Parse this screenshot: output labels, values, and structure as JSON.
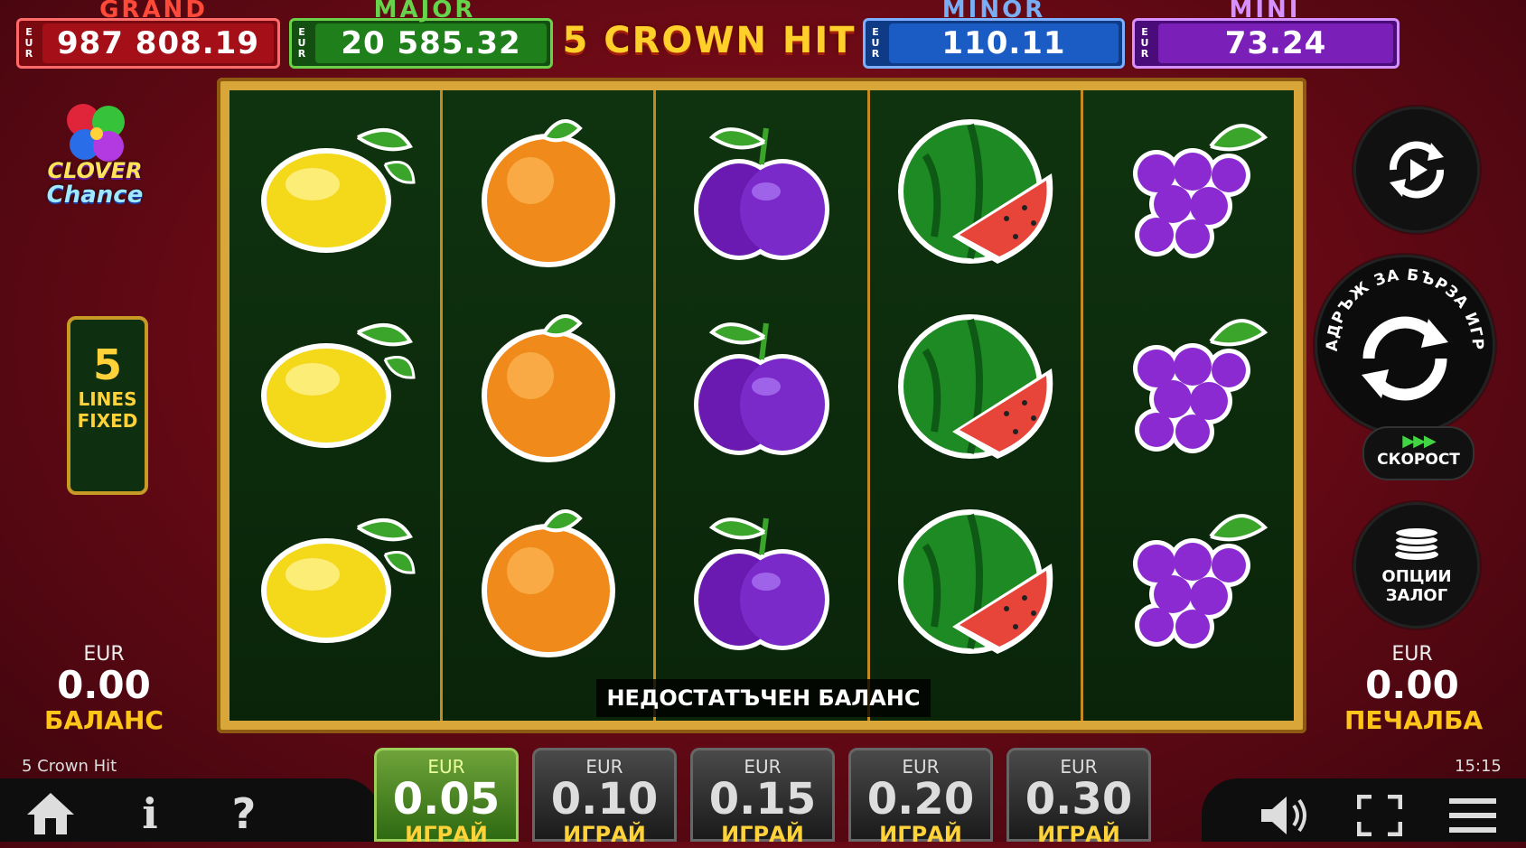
{
  "jackpots": [
    {
      "name": "GRAND",
      "currency": "EUR",
      "value": "987 808.19",
      "color": "#c0141e",
      "title_color": "#ff4a3a"
    },
    {
      "name": "MAJOR",
      "currency": "EUR",
      "value": "20 585.32",
      "color": "#1f7f1a",
      "title_color": "#66d44a"
    },
    {
      "name": "MINOR",
      "currency": "EUR",
      "value": "110.11",
      "color": "#1a5bc4",
      "title_color": "#79aef5"
    },
    {
      "name": "MINI",
      "currency": "EUR",
      "value": "73.24",
      "color": "#7a1fb8",
      "title_color": "#d690ff"
    }
  ],
  "game_logo": "5 CROWN HIT",
  "clover_logo": {
    "line1": "CLOVER",
    "line2": "Chance"
  },
  "lines_badge": {
    "number": "5",
    "line1": "LINES",
    "line2": "FIXED"
  },
  "balance": {
    "currency": "EUR",
    "value": "0.00",
    "label": "БАЛАНС"
  },
  "win": {
    "currency": "EUR",
    "value": "0.00",
    "label": "ПЕЧАЛБА"
  },
  "message": "НЕДОСТАТЪЧЕН БАЛАНС",
  "game_name": "5 Crown Hit",
  "clock": "15:15",
  "reels": [
    [
      "lemon",
      "lemon",
      "lemon"
    ],
    [
      "orange",
      "orange",
      "orange"
    ],
    [
      "plum",
      "plum",
      "plum"
    ],
    [
      "watermelon",
      "watermelon",
      "watermelon"
    ],
    [
      "grapes",
      "grapes",
      "grapes"
    ]
  ],
  "side_buttons": {
    "autoplay_icon": "autoplay-icon",
    "spin_hold_text": "ЗАДРЪЖ ЗА БЪРЗА ИГРА",
    "speed_label": "СКОРОСТ",
    "bet_options_line1": "ОПЦИИ",
    "bet_options_line2": "ЗАЛОГ"
  },
  "bets": [
    {
      "currency": "EUR",
      "value": "0.05",
      "label": "ИГРАЙ",
      "selected": true
    },
    {
      "currency": "EUR",
      "value": "0.10",
      "label": "ИГРАЙ",
      "selected": false
    },
    {
      "currency": "EUR",
      "value": "0.15",
      "label": "ИГРАЙ",
      "selected": false
    },
    {
      "currency": "EUR",
      "value": "0.20",
      "label": "ИГРАЙ",
      "selected": false
    },
    {
      "currency": "EUR",
      "value": "0.30",
      "label": "ИГРАЙ",
      "selected": false
    }
  ],
  "bottom_icons": [
    "home-icon",
    "info-icon",
    "help-icon",
    "sound-icon",
    "fullscreen-icon",
    "menu-icon"
  ]
}
